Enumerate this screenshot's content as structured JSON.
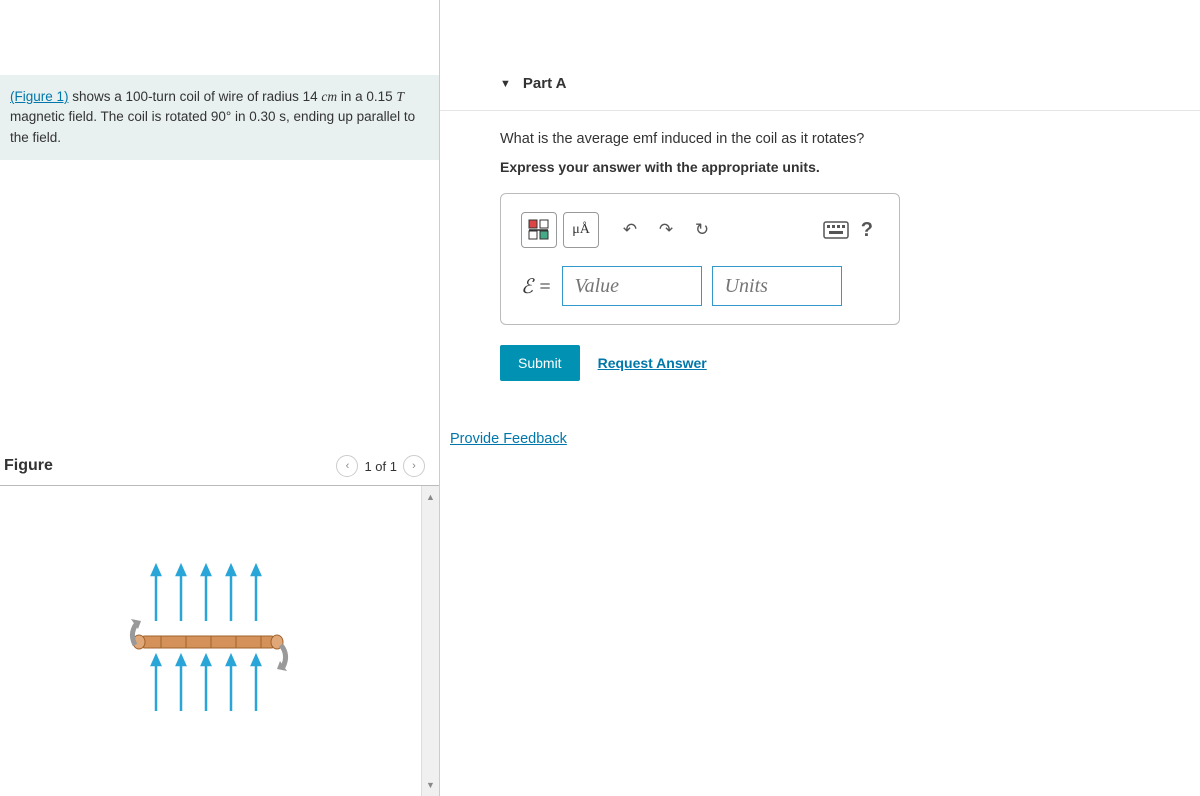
{
  "problem": {
    "figure_link": "(Figure 1)",
    "text_before": " shows a 100-turn coil of wire of radius 14 ",
    "unit1": "cm",
    "text_mid1": " in a 0.15 ",
    "var_T": "T",
    "text_mid2": " magnetic field. The coil is rotated 90° in 0.30 s, ending up parallel to the field."
  },
  "figure": {
    "title": "Figure",
    "nav_text": "1 of 1"
  },
  "part": {
    "label": "Part A",
    "question": "What is the average emf induced in the coil as it rotates?",
    "instruction": "Express your answer with the appropriate units.",
    "toolbar": {
      "units_btn": "μÅ"
    },
    "input": {
      "epsilon": "ℰ =",
      "value_placeholder": "Value",
      "units_placeholder": "Units"
    },
    "submit": "Submit",
    "request": "Request Answer"
  },
  "feedback": "Provide Feedback",
  "icons": {
    "help": "?",
    "undo": "↶",
    "redo": "↷",
    "reset": "↻",
    "prev": "‹",
    "next": "›",
    "up": "▲",
    "down": "▼",
    "toggle": "▼"
  }
}
